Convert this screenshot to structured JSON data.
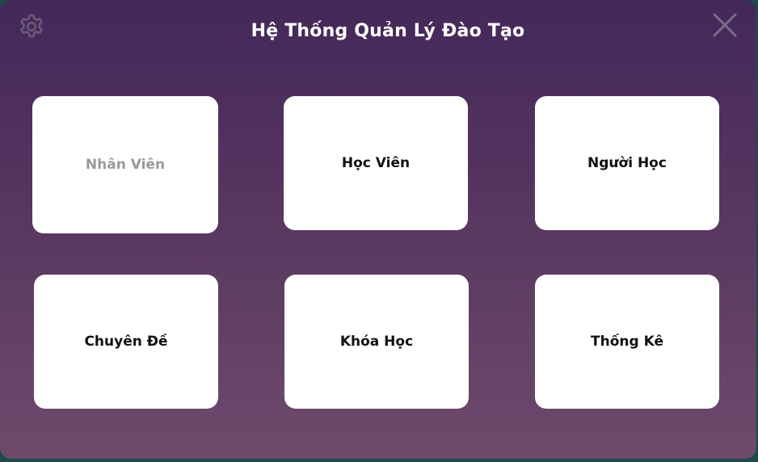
{
  "window": {
    "title": "Hệ Thống Quản Lý Đào Tạo",
    "settings_icon": "gear-icon",
    "close_icon": "close-icon"
  },
  "menu": {
    "items": [
      {
        "label": "Nhân Viên",
        "enabled": false
      },
      {
        "label": "Học Viên",
        "enabled": true
      },
      {
        "label": "Người Học",
        "enabled": true
      },
      {
        "label": "Chuyên Đề",
        "enabled": true
      },
      {
        "label": "Khóa Học",
        "enabled": true
      },
      {
        "label": "Thống Kê",
        "enabled": true
      }
    ]
  },
  "colors": {
    "gradient_top": "#44285a",
    "gradient_bottom": "#6e4b6c",
    "card_background": "#ffffff",
    "disabled_text": "#9a9a9a"
  }
}
